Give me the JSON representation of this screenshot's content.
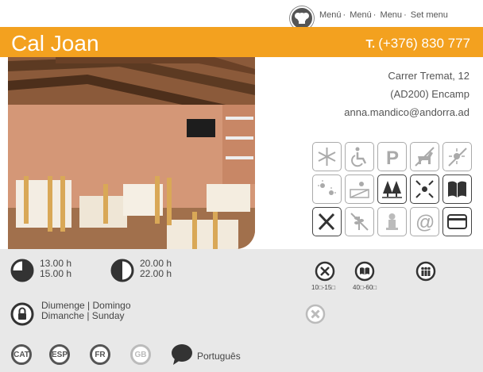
{
  "header": {
    "menu_links": [
      "Menú",
      "Menú",
      "Menu",
      "Set menu"
    ],
    "restaurant_name": "Cal Joan",
    "phone_prefix": "T.",
    "phone_number": "(+376) 830 777"
  },
  "address": {
    "street": "Carrer Tremat, 12",
    "city": "(AD200) Encamp",
    "email": "anna.mandico@andorra.ad"
  },
  "amenities": [
    {
      "name": "air-conditioning-icon",
      "active": false
    },
    {
      "name": "wheelchair-icon",
      "active": false
    },
    {
      "name": "parking-icon",
      "active": false
    },
    {
      "name": "pets-icon",
      "active": false
    },
    {
      "name": "terrace-sun-icon",
      "active": false
    },
    {
      "name": "sunshine-icon",
      "active": false
    },
    {
      "name": "view-icon",
      "active": false
    },
    {
      "name": "forest-icon",
      "active": true
    },
    {
      "name": "center-location-icon",
      "active": true
    },
    {
      "name": "book-menu-icon",
      "active": true
    },
    {
      "name": "cutlery-icon",
      "active": true
    },
    {
      "name": "no-gluten-icon",
      "active": false
    },
    {
      "name": "chef-icon",
      "active": false
    },
    {
      "name": "email-at-icon",
      "active": false
    },
    {
      "name": "credit-card-icon",
      "active": true
    }
  ],
  "schedule": {
    "lunch_open": "13.00 h",
    "lunch_close": "15.00 h",
    "dinner_open": "20.00 h",
    "dinner_close": "22.00 h"
  },
  "prices": {
    "menu_price": "10□-15□",
    "card_price": "40□-60□"
  },
  "closed_days": {
    "line1": "Diumenge | Domingo",
    "line2": "Dimanche | Sunday"
  },
  "languages": [
    {
      "code": "CAT",
      "active": true
    },
    {
      "code": "ESP",
      "active": true
    },
    {
      "code": "FR",
      "active": true
    },
    {
      "code": "GB",
      "active": false
    }
  ],
  "extra_language": "Português",
  "colors": {
    "accent": "#f3a11f",
    "footer": "#e8e8e8"
  }
}
